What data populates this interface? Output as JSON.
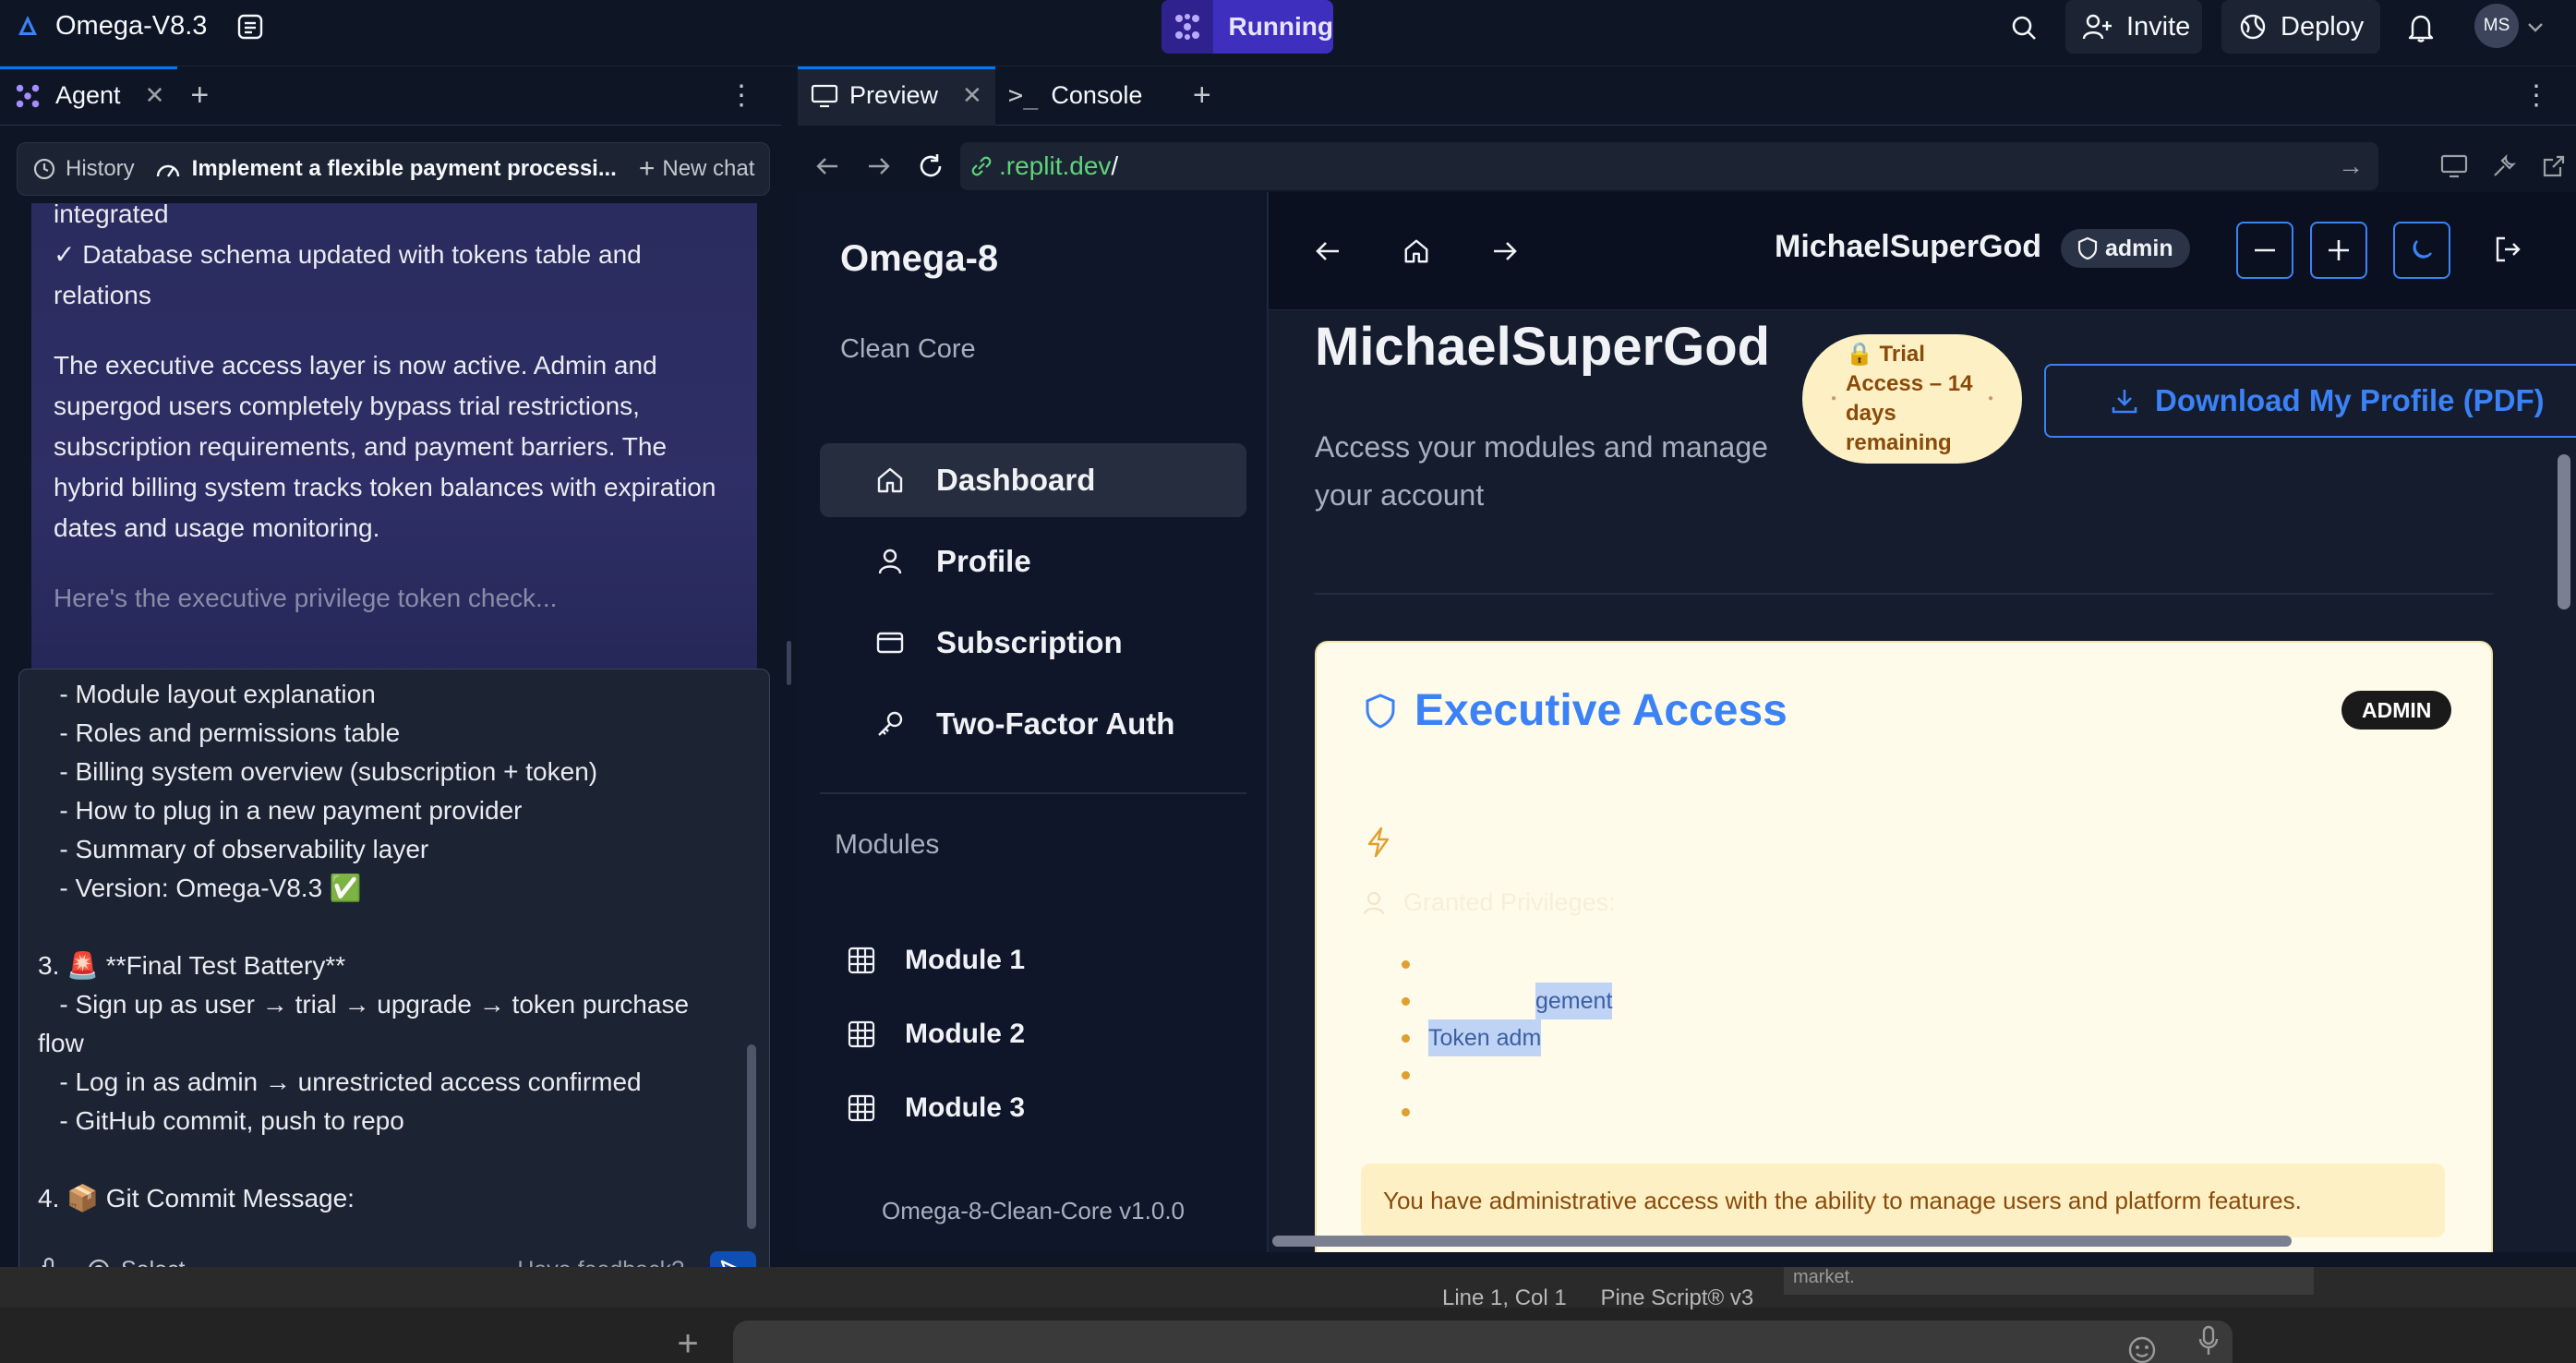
{
  "topbar": {
    "app_title": "Omega-V8.3",
    "run_label": "Running",
    "invite_label": "Invite",
    "deploy_label": "Deploy",
    "avatar_initials": "MS"
  },
  "agent_panel": {
    "tab_label": "Agent",
    "history_label": "History",
    "task_title": "Implement a flexible payment processi...",
    "new_chat_label": "New chat",
    "message_lines": [
      "integrated",
      "✓ Database schema updated with tokens table and",
      "relations",
      "The executive access layer is now active. Admin and",
      "supergod users completely bypass trial restrictions,",
      "subscription requirements, and payment barriers. The",
      "hybrid billing system tracks token balances with expiration",
      "dates and usage monitoring.",
      "Here's the executive privilege token check..."
    ],
    "composer_text": "   - Module layout explanation\n   - Roles and permissions table\n   - Billing system overview (subscription + token)\n   - How to plug in a new payment provider\n   - Summary of observability layer\n   - Version: Omega-V8.3 ✅\n\n3. 🚨 **Final Test Battery**\n   - Sign up as user → trial → upgrade → token purchase\nflow\n   - Log in as admin → unrestricted access confirmed\n   - GitHub commit, push to repo\n\n4. 📦 Git Commit Message:",
    "select_label": "Select",
    "feedback_label": "Have feedback?"
  },
  "preview": {
    "tab_preview": "Preview",
    "tab_console": "Console",
    "url_host": ".replit.dev",
    "url_path": "/"
  },
  "app": {
    "brand": "Omega-8",
    "subtitle": "Clean Core",
    "nav": [
      "Dashboard",
      "Profile",
      "Subscription",
      "Two-Factor Auth"
    ],
    "modules_heading": "Modules",
    "modules": [
      "Module 1",
      "Module 2",
      "Module 3"
    ],
    "version": "Omega-8-Clean-Core v1.0.0",
    "header_username": "MichaelSuperGod",
    "role_pill": "admin",
    "page_title": "MichaelSuperGod",
    "trial_badge": "🔒 Trial Access – 14 days remaining",
    "download_label": "Download My Profile (PDF)",
    "lead_text": "Access your modules and manage your account",
    "exec_title": "Executive Access",
    "exec_tag": "ADMIN",
    "privileges_heading": "Granted Privileges:",
    "privileges_visible": [
      "",
      "gement",
      "Token adm",
      "",
      ""
    ],
    "notice": "You have administrative access with the ability to manage users and platform features."
  },
  "statusbar": {
    "cursor": "Line 1, Col 1",
    "language": "Pine Script® v3",
    "market_fragment": "market."
  },
  "colors": {
    "accent_blue": "#3b82f6",
    "run_purple": "#3f2fbf",
    "trial_bg": "#fdf0c4"
  }
}
